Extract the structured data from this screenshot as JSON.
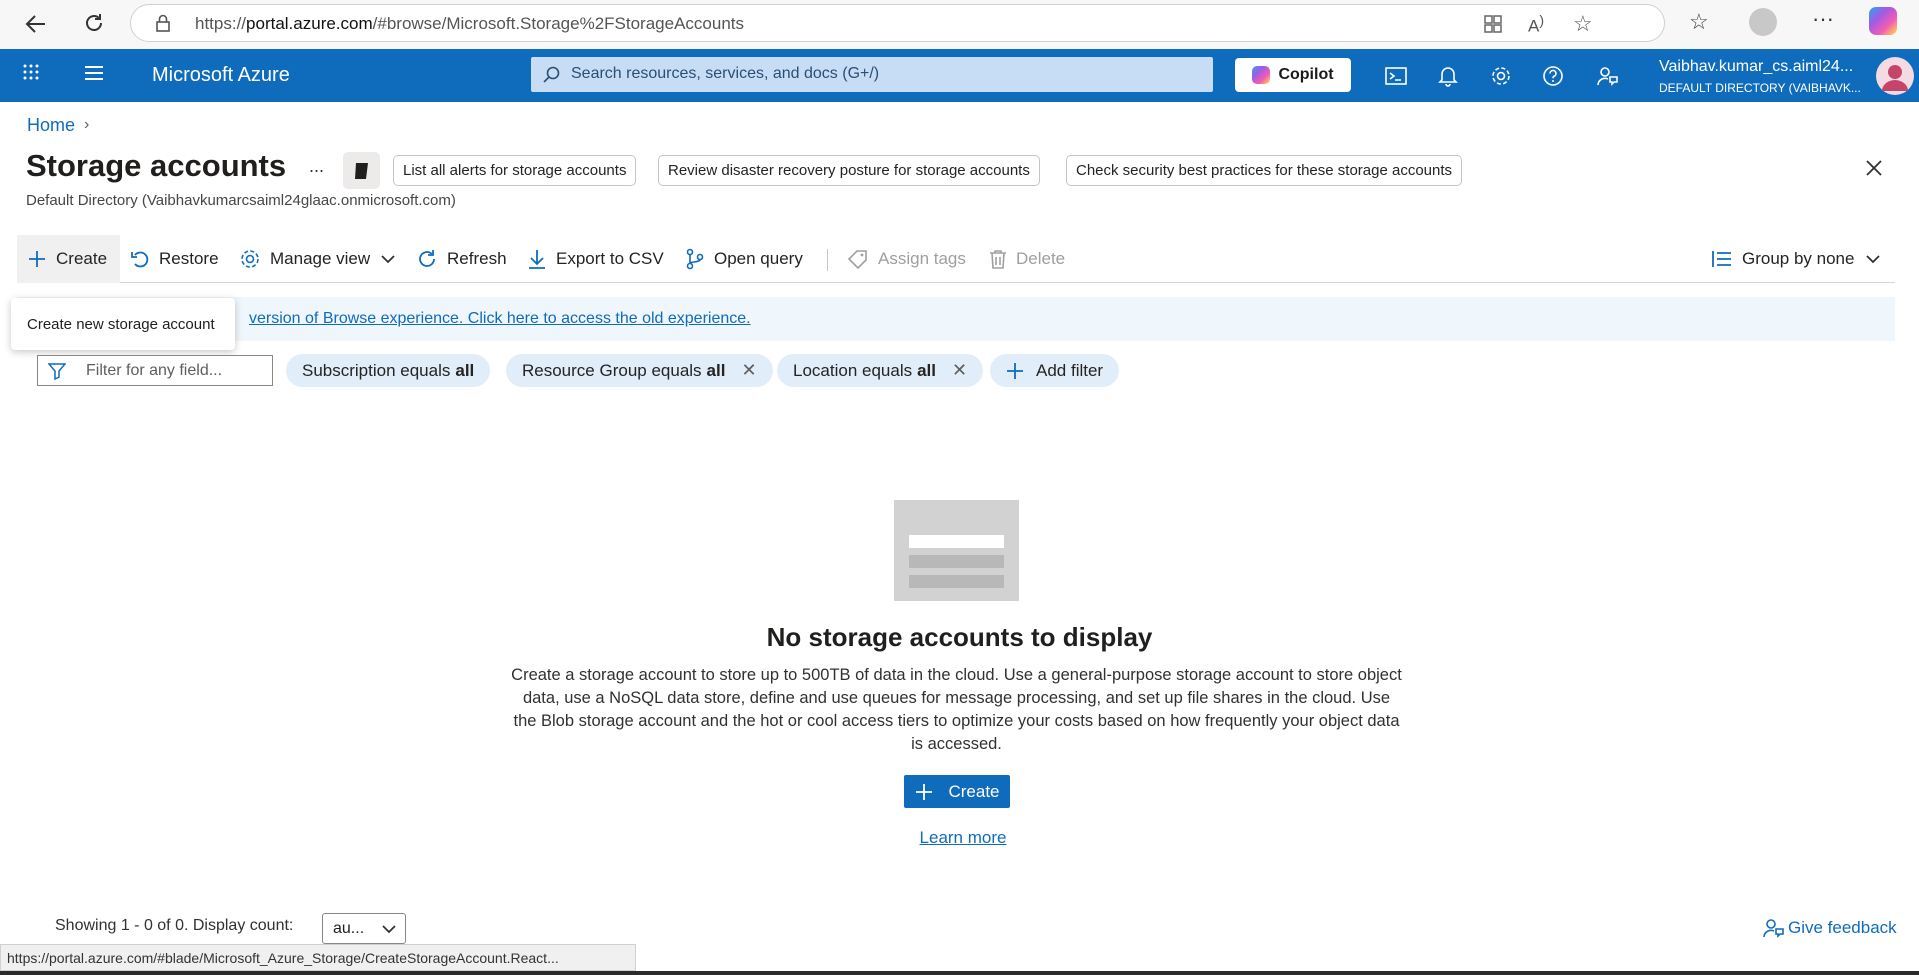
{
  "browser": {
    "url_prefix": "https://",
    "url_host": "portal.azure.com",
    "url_path": "/#browse/Microsoft.Storage%2FStorageAccounts"
  },
  "header": {
    "brand": "Microsoft Azure",
    "search_placeholder": "Search resources, services, and docs (G+/)",
    "copilot_label": "Copilot",
    "user_name": "Vaibhav.kumar_cs.aiml24...",
    "user_directory": "DEFAULT DIRECTORY (VAIBHAVK..."
  },
  "breadcrumb": {
    "home": "Home"
  },
  "page": {
    "title": "Storage accounts",
    "more": "...",
    "subtitle": "Default Directory (Vaibhavkumarcsaiml24glaac.onmicrosoft.com)",
    "suggestions": [
      "List all alerts for storage accounts",
      "Review disaster recovery posture for storage accounts",
      "Check security best practices for these storage accounts"
    ]
  },
  "commands": {
    "create": "Create",
    "restore": "Restore",
    "manage_view": "Manage view",
    "refresh": "Refresh",
    "export_csv": "Export to CSV",
    "open_query": "Open query",
    "assign_tags": "Assign tags",
    "delete": "Delete",
    "group_by": "Group by none"
  },
  "banner": {
    "link_text": "version of Browse experience. Click here to access the old experience."
  },
  "tooltip": {
    "text": "Create new storage account"
  },
  "filters": {
    "placeholder": "Filter for any field...",
    "subscription_label": "Subscription equals",
    "subscription_value": "all",
    "resource_group_label": "Resource Group equals",
    "resource_group_value": "all",
    "location_label": "Location equals",
    "location_value": "all",
    "add_filter": "Add filter"
  },
  "empty_state": {
    "title": "No storage accounts to display",
    "description": "Create a storage account to store up to 500TB of data in the cloud. Use a general-purpose storage account to store object data, use a NoSQL data store, define and use queues for message processing, and set up file shares in the cloud. Use the Blob storage account and the hot or cool access tiers to optimize your costs based on how frequently your object data is accessed.",
    "create_label": "Create",
    "learn_more": "Learn more"
  },
  "footer": {
    "showing": "Showing 1 - 0 of 0. Display count:",
    "display_count": "au...",
    "feedback": "Give feedback"
  },
  "status_bar": {
    "url": "https://portal.azure.com/#blade/Microsoft_Azure_Storage/CreateStorageAccount.React..."
  },
  "colors": {
    "azure_blue": "#0f6cbd",
    "banner_bg": "#eff6fc",
    "pill_bg": "#e1edf8"
  }
}
